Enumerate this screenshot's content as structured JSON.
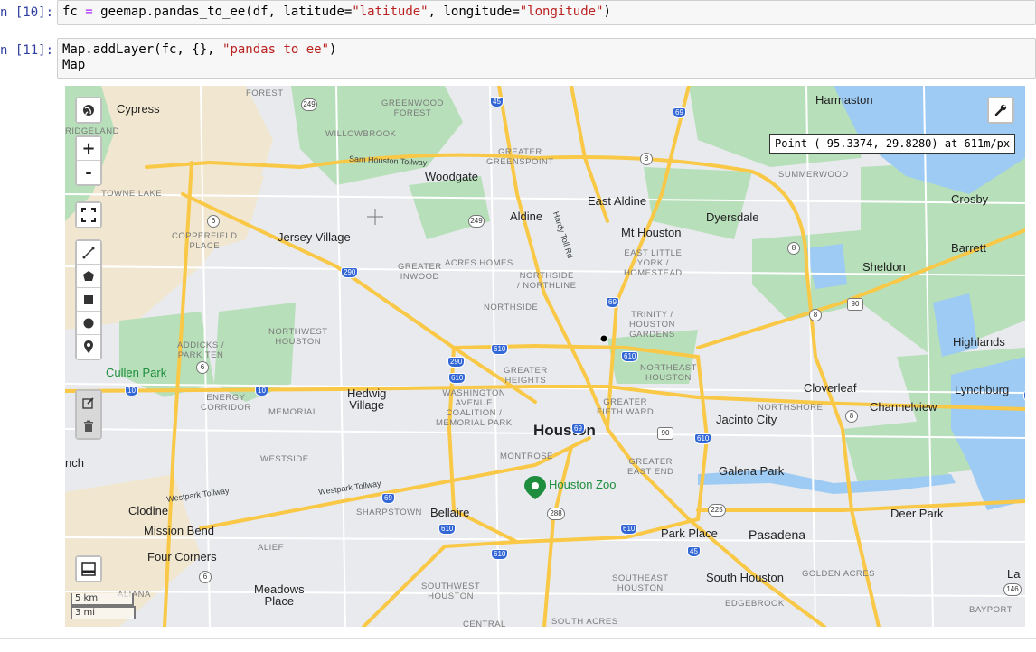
{
  "cells": [
    {
      "prompt": "n [10]:",
      "code_parts": [
        "fc ",
        "=",
        " geemap.pandas_to_ee(df, latitude=",
        "\"latitude\"",
        ", longitude=",
        "\"longitude\"",
        ")"
      ]
    },
    {
      "prompt": "n [11]:",
      "line1_parts": [
        "Map.addLayer(fc, {}, ",
        "\"pandas to ee\"",
        ")"
      ],
      "line2": "Map"
    }
  ],
  "map": {
    "tooltip": "Point (-95.3374, 29.8280) at 611m/px",
    "zoom_in": "+",
    "zoom_out": "-",
    "scale_km": "5 km",
    "scale_mi": "3 mi",
    "labels": {
      "cypress": "Cypress",
      "harmaston": "Harmaston",
      "ridgeland": "RIDGELAND",
      "willowbrook": "WILLOWBROOK",
      "greenwood_forest": "GREENWOOD\nFOREST",
      "forest": "FOREST",
      "greater_greenspoint": "GREATER\nGREENSPOINT",
      "sam_houston_tollway": "Sam Houston Tollway",
      "woodgate": "Woodgate",
      "summerwood": "SUMMERWOOD",
      "towne_lake": "TOWNE LAKE",
      "east_aldine": "East Aldine",
      "crosby": "Crosby",
      "aldine": "Aldine",
      "hardy_toll_rd": "Hardy Toll Rd",
      "dyersdale": "Dyersdale",
      "copperfield_place": "COPPERFIELD\nPLACE",
      "jersey_village": "Jersey Village",
      "mt_houston": "Mt Houston",
      "barrett": "Barrett",
      "east_little_york": "EAST LITTLE\nYORK /\nHOMESTEAD",
      "greater_inwood": "GREATER\nINWOOD",
      "acres_homes": "ACRES HOMES",
      "sheldon": "Sheldon",
      "northside_northline": "NORTHSIDE\n/ NORTHLINE",
      "northside": "NORTHSIDE",
      "trinity_houston_gardens": "TRINITY /\nHOUSTON\nGARDENS",
      "northwest_houston": "NORTHWEST\nHOUSTON",
      "addicks_park_ten": "ADDICKS /\nPARK TEN",
      "highlands": "Highlands",
      "cullen_park": "Cullen Park",
      "greater_heights": "GREATER\nHEIGHTS",
      "northeast_houston": "NORTHEAST\nHOUSTON",
      "cloverleaf": "Cloverleaf",
      "lynchburg": "Lynchburg",
      "energy_corridor": "ENERGY\nCORRIDOR",
      "hedwig_village": "Hedwig\nVillage",
      "washington_avenue": "WASHINGTON\nAVENUE\nCOALITION /\nMEMORIAL PARK",
      "greater_fifth_ward": "GREATER\nFIFTH WARD",
      "northshore": "NORTHSHORE",
      "channelview": "Channelview",
      "memorial": "MEMORIAL",
      "jacinto_city": "Jacinto City",
      "houston": "Houston",
      "nch": "nch",
      "westside": "WESTSIDE",
      "montrose": "MONTROSE",
      "greater_east_end": "GREATER\nEAST END",
      "galena_park": "Galena Park",
      "houston_zoo": "Houston Zoo",
      "westpark_tollway": "Westpark Tollway",
      "clodine": "Clodine",
      "sharpstown": "SHARPSTOWN",
      "bellaire": "Bellaire",
      "deer_park": "Deer Park",
      "mission_bend": "Mission Bend",
      "park_place": "Park Place",
      "pasadena": "Pasadena",
      "four_corners": "Four Corners",
      "alief": "ALIEF",
      "southeast_houston": "SOUTHEAST\nHOUSTON",
      "south_houston": "South Houston",
      "golden_acres": "GOLDEN ACRES",
      "la": "La",
      "meadows_place": "Meadows\nPlace",
      "southwest_houston": "SOUTHWEST\nHOUSTON",
      "aliana": "ALIANA",
      "edgebrook": "EDGEBROOK",
      "bayport": "BAYPORT",
      "central": "CENTRAL",
      "south_acres": "SOUTH ACRES"
    },
    "shields": {
      "i45_n": "45",
      "i69_n": "69",
      "s249_a": "249",
      "s249_b": "249",
      "s8_a": "8",
      "s8_b": "8",
      "s8_c": "8",
      "s8_d": "8",
      "s6_a": "6",
      "s6_b": "6",
      "s6_c": "6",
      "s290_a": "290",
      "s290_b": "290",
      "i69_c": "69",
      "i610_a": "610",
      "i610_b": "610",
      "i610_c": "610",
      "i610_d": "610",
      "i610_e": "610",
      "i610_f": "610",
      "i10_a": "10",
      "i10_b": "10",
      "i10_c": "10",
      "s90": "90",
      "alt90": "90",
      "i69_h": "69",
      "i69_s": "69",
      "s288": "288",
      "s225": "225",
      "i45_s": "45",
      "s146": "146",
      "i610_sw": "610"
    },
    "colors": {
      "park": "#b7dfb9",
      "land": "#e8eaed",
      "tan": "#f1e7d0",
      "water": "#9ecbf3",
      "highway": "#f9c846",
      "road": "#ffffff"
    }
  }
}
